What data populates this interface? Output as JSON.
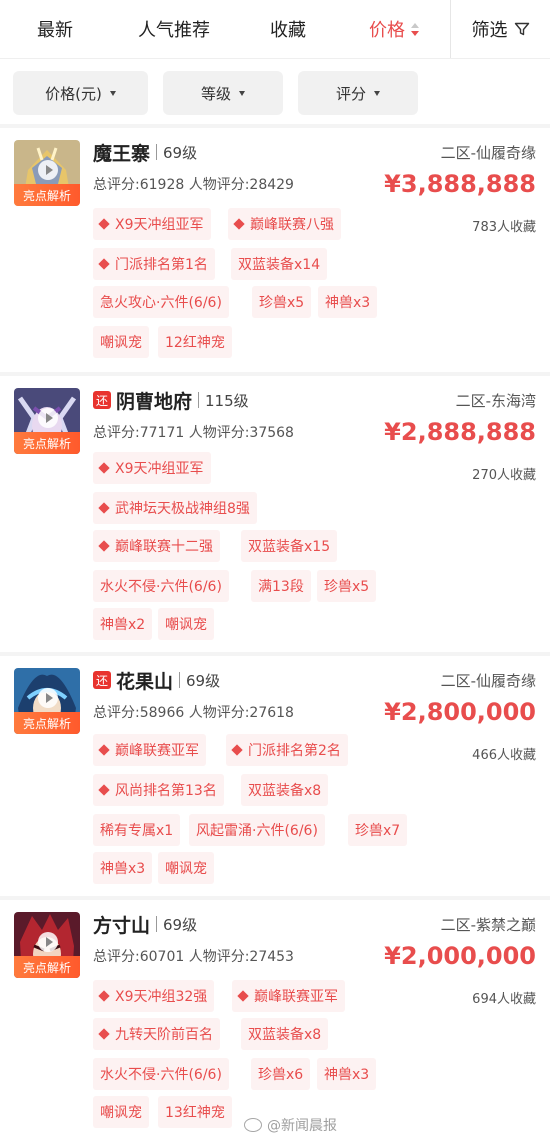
{
  "sort_bar": {
    "items": [
      "最新",
      "人气推荐",
      "收藏",
      "价格"
    ],
    "active": "价格",
    "filter_label": "筛选"
  },
  "filters": [
    "价格(元)",
    "等级",
    "评分"
  ],
  "avatar_badge": "亮点解析",
  "return_badge": "还",
  "listings": [
    {
      "name": "魔王寨",
      "level": "69级",
      "server": "二区-仙履奇缘",
      "scores": "总评分:61928 人物评分:28429",
      "price": "¥3,888,888",
      "favorites": "783人收藏",
      "returned": false,
      "tags": [
        "X9天冲组亚军",
        "巅峰联赛八强",
        "门派排名第1名",
        "双蓝装备x14",
        "急火攻心·六件(6/6)",
        "珍兽x5",
        "神兽x3",
        "嘲讽宠",
        "12红神宠"
      ]
    },
    {
      "name": "阴曹地府",
      "level": "115级",
      "server": "二区-东海湾",
      "scores": "总评分:77171 人物评分:37568",
      "price": "¥2,888,888",
      "favorites": "270人收藏",
      "returned": true,
      "tags": [
        "X9天冲组亚军",
        "武神坛天极战神组8强",
        "巅峰联赛十二强",
        "双蓝装备x15",
        "水火不侵·六件(6/6)",
        "满13段",
        "珍兽x5",
        "神兽x2",
        "嘲讽宠"
      ]
    },
    {
      "name": "花果山",
      "level": "69级",
      "server": "二区-仙履奇缘",
      "scores": "总评分:58966 人物评分:27618",
      "price": "¥2,800,000",
      "favorites": "466人收藏",
      "returned": true,
      "tags": [
        "巅峰联赛亚军",
        "门派排名第2名",
        "风尚排名第13名",
        "双蓝装备x8",
        "稀有专属x1",
        "风起雷涌·六件(6/6)",
        "珍兽x7",
        "神兽x3",
        "嘲讽宠"
      ]
    },
    {
      "name": "方寸山",
      "level": "69级",
      "server": "二区-紫禁之巅",
      "scores": "总评分:60701 人物评分:27453",
      "price": "¥2,000,000",
      "favorites": "694人收藏",
      "returned": false,
      "tags": [
        "X9天冲组32强",
        "巅峰联赛亚军",
        "九转天阶前百名",
        "双蓝装备x8",
        "水火不侵·六件(6/6)",
        "珍兽x6",
        "神兽x3",
        "嘲讽宠",
        "13红神宠"
      ]
    }
  ],
  "watermark": "@新闻晨报",
  "colors": {
    "accent": "#e84d4d",
    "tag_bg": "#fdf2f2",
    "badge_orange": "#ff6a33",
    "return_red": "#e8332e"
  }
}
